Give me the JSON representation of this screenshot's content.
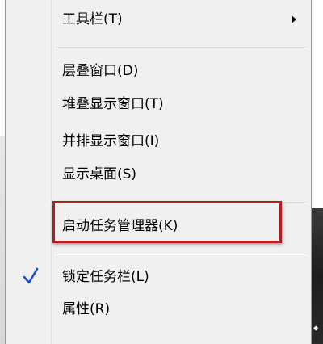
{
  "menu": {
    "items": [
      {
        "label": "工具栏(T)",
        "has_submenu": true,
        "checked": false
      },
      {
        "label": "层叠窗口(D)",
        "has_submenu": false,
        "checked": false
      },
      {
        "label": "堆叠显示窗口(T)",
        "has_submenu": false,
        "checked": false
      },
      {
        "label": "并排显示窗口(I)",
        "has_submenu": false,
        "checked": false
      },
      {
        "label": "显示桌面(S)",
        "has_submenu": false,
        "checked": false
      },
      {
        "label": "启动任务管理器(K)",
        "has_submenu": false,
        "checked": false,
        "highlighted": true
      },
      {
        "label": "锁定任务栏(L)",
        "has_submenu": false,
        "checked": true
      },
      {
        "label": "属性(R)",
        "has_submenu": false,
        "checked": false
      }
    ]
  },
  "colors": {
    "menu_background": "#f0f0f0",
    "highlight_border": "#b21e1e",
    "check_color": "#1f4fbf",
    "text": "#000000"
  },
  "icons": {
    "submenu_arrow": "chevron-right-icon",
    "checkmark": "checkmark-icon"
  }
}
